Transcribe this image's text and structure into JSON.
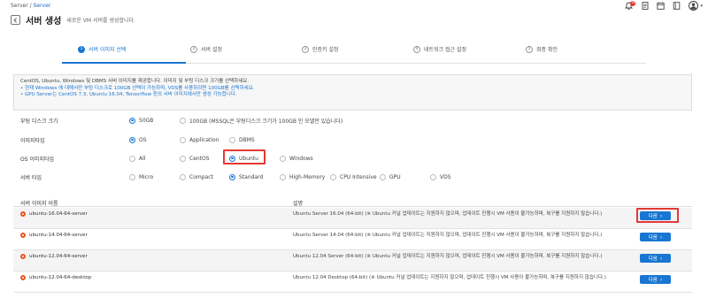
{
  "breadcrumb": {
    "root": "Server",
    "sep": "/",
    "current": "Server"
  },
  "page": {
    "title": "서버 생성",
    "subtitle": "새로운 VM 서버를 생성합니다."
  },
  "top_icons": {
    "notification_count": "9"
  },
  "steps": [
    {
      "num": "1",
      "label": "서버 이미지 선택",
      "active": true
    },
    {
      "num": "2",
      "label": "서버 설정",
      "active": false
    },
    {
      "num": "3",
      "label": "인증키 설정",
      "active": false
    },
    {
      "num": "4",
      "label": "네트워크 접근 설정",
      "active": false
    },
    {
      "num": "5",
      "label": "최종 확인",
      "active": false
    }
  ],
  "info": {
    "line1": "CentOS, Ubuntu, Windows 및 DBMS 서버 이미지를 제공합니다. 이미지 및 부팅 디스크 크기를 선택하세요.",
    "line2": "• 현재 Windows 에 대해서만 부팅 디스크로 100GB 선택이 가능하며, VDS를 사용하려면 100GB를 선택하세요.",
    "line3": "• GPU Server는 CentOS 7.3, Ubuntu 16.04, Tensorflow 등의 서버 이미지에서만 생성 가능합니다."
  },
  "options": {
    "boot_disk": {
      "label": "부팅 디스크 크기",
      "choices": [
        "50GB",
        "100GB (MSSQL은 부팅디스크 크기가 100GB 인 모델만 있습니다)"
      ],
      "selected": 0
    },
    "image_type": {
      "label": "이미지타입",
      "choices": [
        "OS",
        "Application",
        "DBMS"
      ],
      "selected": 0
    },
    "os_image_type": {
      "label": "OS 이미지타입",
      "choices": [
        "All",
        "CentOS",
        "Ubuntu",
        "Windows"
      ],
      "selected": 2
    },
    "server_type": {
      "label": "서버 타입",
      "choices": [
        "Micro",
        "Compact",
        "Standard",
        "High-Memory",
        "CPU Intensive",
        "GPU",
        "VDS"
      ],
      "selected": 2
    }
  },
  "table": {
    "col_name": "서버 이미지 이름",
    "col_desc": "설명",
    "next_label": "다음",
    "rows": [
      {
        "name": "ubuntu-16.04-64-server",
        "desc": "Ubuntu Server 16.04 (64-bit) (※ Ubuntu 커널 업데이트는 지원하지 않으며, 업데이트 진행시 VM 사용이 불가능하며, 복구를 지원하지 않습니다.)"
      },
      {
        "name": "ubuntu-14.04-64-server",
        "desc": "Ubuntu Server 14.04 (64-bit) (※ Ubuntu 커널 업데이트는 지원하지 않으며, 업데이트 진행시 VM 사용이 불가능하며, 복구를 지원하지 않습니다.)"
      },
      {
        "name": "ubuntu-12.04-64-server",
        "desc": "Ubuntu 12.04 Server (64-bit) (※ Ubuntu 커널 업데이트는 지원하지 않으며, 업데이트 진행시 VM 사용이 불가능하며, 복구를 지원하지 않습니다.)"
      },
      {
        "name": "ubuntu-12.04-64-desktop",
        "desc": "Ubuntu 12.04 Desktop (64-bit) (※ Ubuntu 커널 업데이트는 지원하지 않으며, 업데이트 진행시 VM 사용이 불가능하며, 복구를 지원하지 않습니다.)"
      }
    ]
  },
  "colors": {
    "accent": "#1976d2",
    "highlight": "#e53935",
    "ubuntu": "#e95420"
  }
}
